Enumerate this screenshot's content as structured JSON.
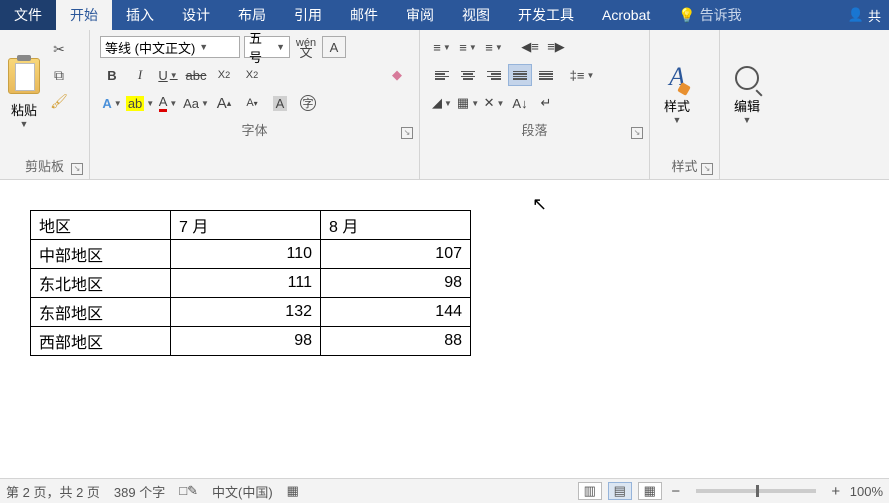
{
  "tabs": {
    "file": "文件",
    "home": "开始",
    "insert": "插入",
    "design": "设计",
    "layout": "布局",
    "references": "引用",
    "mailings": "邮件",
    "review": "审阅",
    "view": "视图",
    "developer": "开发工具",
    "acrobat": "Acrobat",
    "tell_me": "告诉我",
    "share": "共"
  },
  "ribbon": {
    "clipboard": {
      "label": "剪贴板",
      "paste": "粘贴"
    },
    "font": {
      "label": "字体",
      "name": "等线 (中文正文)",
      "size": "五号",
      "wen": "wén",
      "wen2": "文"
    },
    "paragraph": {
      "label": "段落"
    },
    "styles": {
      "label": "样式",
      "btn": "样式"
    },
    "editing": {
      "label": "",
      "btn": "编辑"
    }
  },
  "table": {
    "headers": [
      "地区",
      "7 月",
      "8 月"
    ],
    "rows": [
      {
        "region": "中部地区",
        "jul": "110",
        "aug": "107"
      },
      {
        "region": "东北地区",
        "jul": "111",
        "aug": "98"
      },
      {
        "region": "东部地区",
        "jul": "132",
        "aug": "144"
      },
      {
        "region": "西部地区",
        "jul": "98",
        "aug": "88"
      }
    ]
  },
  "status": {
    "page": "第 2 页，共 2 页",
    "words": "389 个字",
    "lang": "中文(中国)",
    "zoom": "100%"
  }
}
